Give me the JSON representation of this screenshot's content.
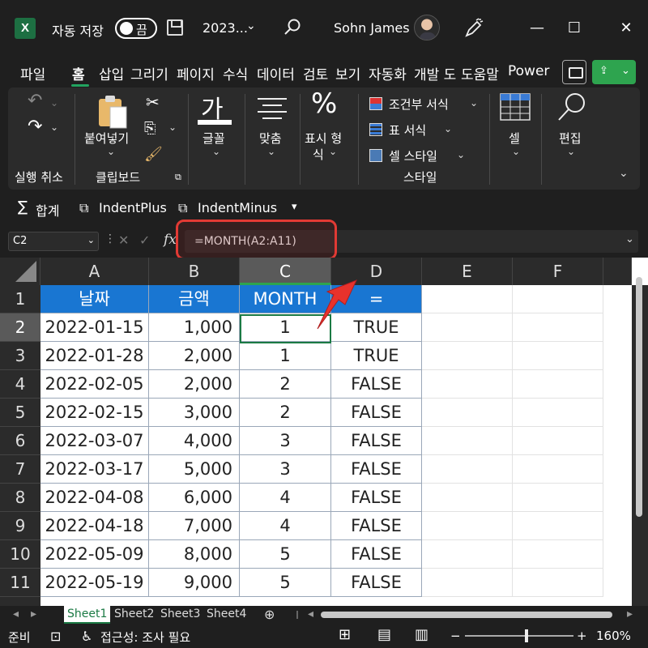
{
  "titlebar": {
    "autosave_label": "자동 저장",
    "toggle_state": "끔",
    "filename": "2023...",
    "username": "Sohn James",
    "app_icon": "excel-logo",
    "minimize": "—",
    "maximize": "☐",
    "close": "✕"
  },
  "tabs": [
    "파일",
    "홈",
    "삽입",
    "그리기",
    "페이지",
    "수식",
    "데이터",
    "검토",
    "보기",
    "자동화",
    "개발 도",
    "도움말",
    "Power"
  ],
  "active_tab": "홈",
  "ribbon": {
    "undo_group": "실행 취소",
    "paste": "붙여넣기",
    "clipboard_group": "클립보드",
    "font_glyph": "가",
    "font": "글꼴",
    "align": "맞춤",
    "number_glyph": "%",
    "number": "표시 형",
    "number_line2": "식",
    "cond_format": "조건부 서식",
    "table_format": "표 서식",
    "cell_style": "셀 스타일",
    "styles_group": "스타일",
    "cells": "셀",
    "editing": "편집"
  },
  "qat": {
    "sum": "합계",
    "indent_plus": "IndentPlus",
    "indent_minus": "IndentMinus"
  },
  "formula_bar": {
    "name_box": "C2",
    "fx": "fx",
    "formula": "=MONTH(A2:A11)"
  },
  "grid": {
    "columns": [
      "A",
      "B",
      "C",
      "D",
      "E",
      "F"
    ],
    "selected_column": "C",
    "selected_row": "2",
    "header_row": [
      "날짜",
      "금액",
      "MONTH",
      "="
    ],
    "rows": [
      {
        "n": "2",
        "date": "2022-01-15",
        "amount": "1,000",
        "month": "1",
        "eq": "TRUE"
      },
      {
        "n": "3",
        "date": "2022-01-28",
        "amount": "2,000",
        "month": "1",
        "eq": "TRUE"
      },
      {
        "n": "4",
        "date": "2022-02-05",
        "amount": "2,000",
        "month": "2",
        "eq": "FALSE"
      },
      {
        "n": "5",
        "date": "2022-02-15",
        "amount": "3,000",
        "month": "2",
        "eq": "FALSE"
      },
      {
        "n": "6",
        "date": "2022-03-07",
        "amount": "4,000",
        "month": "3",
        "eq": "FALSE"
      },
      {
        "n": "7",
        "date": "2022-03-17",
        "amount": "5,000",
        "month": "3",
        "eq": "FALSE"
      },
      {
        "n": "8",
        "date": "2022-04-08",
        "amount": "6,000",
        "month": "4",
        "eq": "FALSE"
      },
      {
        "n": "9",
        "date": "2022-04-18",
        "amount": "7,000",
        "month": "4",
        "eq": "FALSE"
      },
      {
        "n": "10",
        "date": "2022-05-09",
        "amount": "8,000",
        "month": "5",
        "eq": "FALSE"
      },
      {
        "n": "11",
        "date": "2022-05-19",
        "amount": "9,000",
        "month": "5",
        "eq": "FALSE"
      }
    ],
    "header_color": "#1976d2"
  },
  "sheets": [
    "Sheet1",
    "Sheet2",
    "Sheet3",
    "Sheet4"
  ],
  "active_sheet": "Sheet1",
  "status": {
    "ready": "준비",
    "accessibility": "접근성: 조사 필요",
    "zoom": "160%"
  },
  "colors": {
    "accent_green": "#2ea44f",
    "highlight_red": "#e23a34"
  }
}
